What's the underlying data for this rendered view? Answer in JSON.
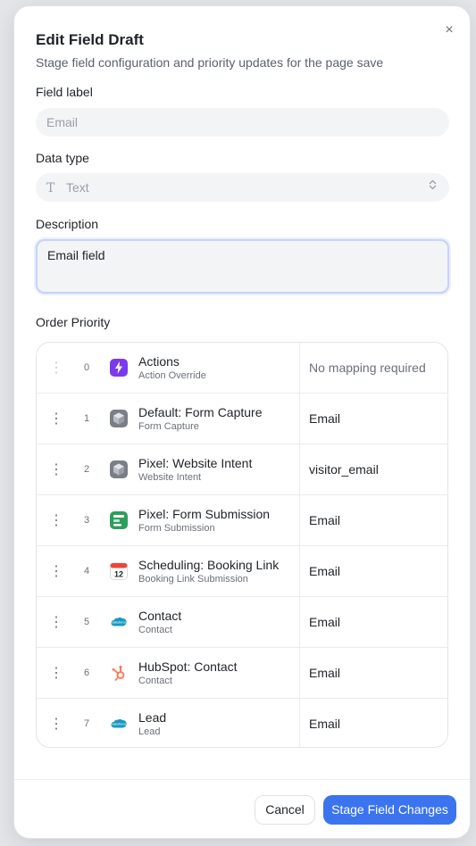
{
  "modal": {
    "title": "Edit Field Draft",
    "subtitle": "Stage field configuration and priority updates for the page save",
    "close_icon": "×"
  },
  "fields": {
    "label_label": "Field label",
    "label_placeholder": "Email",
    "type_label": "Data type",
    "type_value": "Text",
    "type_icon": "T",
    "description_label": "Description",
    "description_value": "Email field"
  },
  "priority": {
    "label": "Order Priority",
    "rows": [
      {
        "num": "0",
        "name": "Actions",
        "sub": "Action Override",
        "mapping": "No mapping required",
        "icon": "lightning-icon",
        "color": "#7c3aed"
      },
      {
        "num": "1",
        "name": "Default: Form Capture",
        "sub": "Form Capture",
        "mapping": "Email",
        "icon": "cube-icon",
        "color": "#7a7e85"
      },
      {
        "num": "2",
        "name": "Pixel: Website Intent",
        "sub": "Website Intent",
        "mapping": "visitor_email",
        "icon": "cube-icon",
        "color": "#7a7e85"
      },
      {
        "num": "3",
        "name": "Pixel: Form Submission",
        "sub": "Form Submission",
        "mapping": "Email",
        "icon": "form-icon",
        "color": "#2f9e5b"
      },
      {
        "num": "4",
        "name": "Scheduling: Booking Link",
        "sub": "Booking Link Submission",
        "mapping": "Email",
        "icon": "calendar-icon",
        "color": "#e8483c"
      },
      {
        "num": "5",
        "name": "Contact",
        "sub": "Contact",
        "mapping": "Email",
        "icon": "salesforce-cloud-icon",
        "color": "#1798c1"
      },
      {
        "num": "6",
        "name": "HubSpot: Contact",
        "sub": "Contact",
        "mapping": "Email",
        "icon": "hubspot-icon",
        "color": "#ff7a59"
      },
      {
        "num": "7",
        "name": "Lead",
        "sub": "Lead",
        "mapping": "Email",
        "icon": "salesforce-cloud-icon",
        "color": "#1798c1"
      }
    ]
  },
  "footer": {
    "cancel_label": "Cancel",
    "submit_label": "Stage Field Changes"
  },
  "colors": {
    "accent": "#3b74ee",
    "focus_border": "#c7d2fb"
  }
}
